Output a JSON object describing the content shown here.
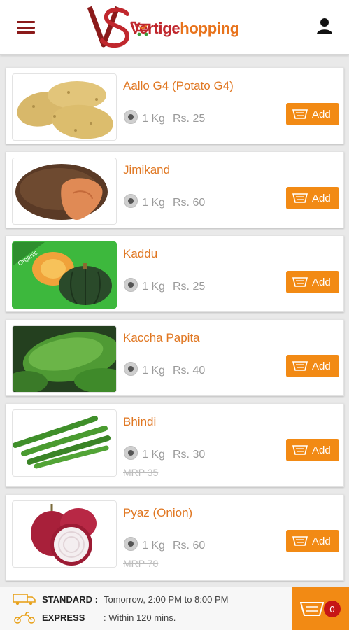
{
  "header": {
    "brand_part1": "Vertige",
    "brand_part2": "hopping",
    "logo_monogram": "VS"
  },
  "products": [
    {
      "name": "Aallo G4 (Potato G4)",
      "qty": "1 Kg",
      "price": "Rs. 25",
      "mrp": "",
      "add_label": "Add",
      "image": "potato"
    },
    {
      "name": "Jimikand",
      "qty": "1 Kg",
      "price": "Rs. 60",
      "mrp": "",
      "add_label": "Add",
      "image": "yam"
    },
    {
      "name": "Kaddu",
      "qty": "1 Kg",
      "price": "Rs. 25",
      "mrp": "",
      "add_label": "Add",
      "image": "pumpkin",
      "badge": "Organic"
    },
    {
      "name": "Kaccha Papita",
      "qty": "1 Kg",
      "price": "Rs. 40",
      "mrp": "",
      "add_label": "Add",
      "image": "papaya"
    },
    {
      "name": "Bhindi",
      "qty": "1 Kg",
      "price": "Rs. 30",
      "mrp": "MRP 35",
      "add_label": "Add",
      "image": "okra"
    },
    {
      "name": "Pyaz (Onion)",
      "qty": "1 Kg",
      "price": "Rs. 60",
      "mrp": "MRP 70",
      "add_label": "Add",
      "image": "onion"
    }
  ],
  "delivery": {
    "standard_label": "STANDARD :",
    "standard_value": "Tomorrow, 2:00 PM to 8:00 PM",
    "express_label": "EXPRESS",
    "express_value": ": Within 120 mins."
  },
  "cart": {
    "count": "0"
  },
  "colors": {
    "accent": "#f28a14",
    "title": "#e07722",
    "brand_red": "#c0272d",
    "badge": "#c61616"
  }
}
